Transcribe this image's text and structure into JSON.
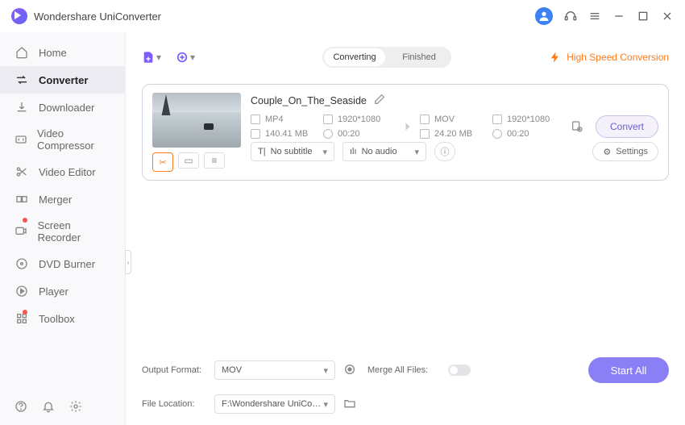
{
  "app_title": "Wondershare UniConverter",
  "sidebar": {
    "items": [
      {
        "label": "Home"
      },
      {
        "label": "Converter"
      },
      {
        "label": "Downloader"
      },
      {
        "label": "Video Compressor"
      },
      {
        "label": "Video Editor"
      },
      {
        "label": "Merger"
      },
      {
        "label": "Screen Recorder"
      },
      {
        "label": "DVD Burner"
      },
      {
        "label": "Player"
      },
      {
        "label": "Toolbox"
      }
    ]
  },
  "tabs": {
    "converting": "Converting",
    "finished": "Finished"
  },
  "hsc_label": "High Speed Conversion",
  "file": {
    "name": "Couple_On_The_Seaside",
    "src": {
      "format": "MP4",
      "res": "1920*1080",
      "size": "140.41 MB",
      "dur": "00:20"
    },
    "dst": {
      "format": "MOV",
      "res": "1920*1080",
      "size": "24.20 MB",
      "dur": "00:20"
    },
    "subtitle": "No subtitle",
    "audio": "No audio",
    "settings": "Settings",
    "convert": "Convert"
  },
  "footer": {
    "output_format_label": "Output Format:",
    "output_format_value": "MOV",
    "file_location_label": "File Location:",
    "file_location_value": "F:\\Wondershare UniConverter",
    "merge_label": "Merge All Files:",
    "start": "Start All"
  }
}
